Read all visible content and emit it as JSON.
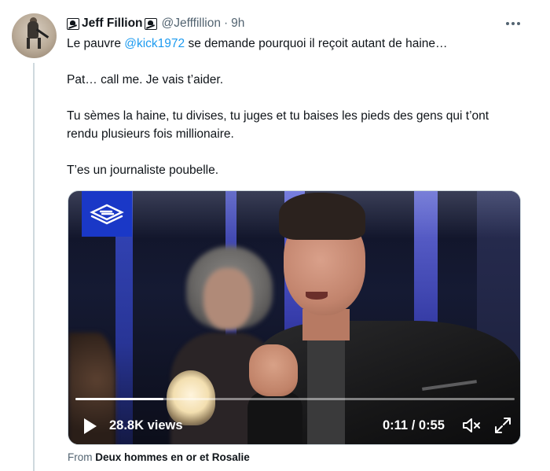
{
  "author": {
    "name": "Jeff Fillion",
    "handle": "@Jefffillion",
    "separator": "·",
    "time": "9h",
    "name_icon": "skull-crossbones-icon"
  },
  "tweet": {
    "line1_prefix": "Le pauvre ",
    "mention": "@kick1972",
    "line1_suffix": " se demande pourquoi il reçoit autant de haine…",
    "para2": "Pat… call me. Je vais t’aider.",
    "para3": "Tu sèmes la haine, tu divises, tu juges et tu baises les pieds des gens qui t’ont rendu plusieurs fois millionaire.",
    "para4": "T’es un journaliste poubelle."
  },
  "video": {
    "views": "28.8K views",
    "current_time": "0:11",
    "time_separator": " / ",
    "duration": "0:55",
    "progress": 0.2,
    "accent_color": "#1a38c7"
  },
  "source": {
    "prefix": "From ",
    "name": "Deux hommes en or et Rosalie"
  },
  "colors": {
    "text": "#0f1419",
    "secondary": "#536471",
    "link": "#1d9bf0"
  }
}
